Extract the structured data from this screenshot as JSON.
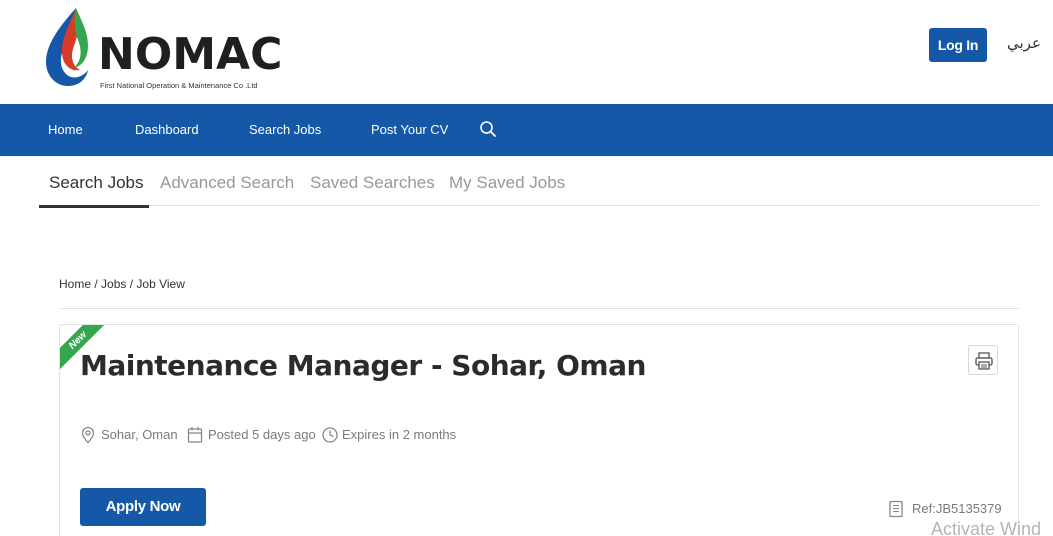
{
  "header": {
    "logo_text": "NOMAC",
    "logo_subtitle": "First National Operation & Maintenance Co .Ltd",
    "login_label": "Log In",
    "language_label": "عربي"
  },
  "nav": {
    "items": [
      {
        "label": "Home"
      },
      {
        "label": "Dashboard"
      },
      {
        "label": "Search Jobs"
      },
      {
        "label": "Post Your CV"
      }
    ],
    "search_icon": "search-icon"
  },
  "tabs": [
    {
      "label": "Search Jobs",
      "active": true
    },
    {
      "label": "Advanced Search",
      "active": false
    },
    {
      "label": "Saved Searches",
      "active": false
    },
    {
      "label": "My Saved Jobs",
      "active": false
    }
  ],
  "breadcrumb": {
    "home": "Home",
    "sep1": " / ",
    "jobs": "Jobs",
    "sep2": " / ",
    "current": "Job View"
  },
  "job": {
    "badge": "New",
    "title": "Maintenance Manager - Sohar, Oman",
    "location": "Sohar, Oman",
    "posted": "Posted 5 days ago",
    "expires": "Expires in 2 months",
    "apply_label": "Apply Now",
    "ref": "Ref:JB5135379"
  },
  "colors": {
    "brand_blue": "#1558a7",
    "new_badge_green": "#33a74d"
  },
  "watermark": "Activate Wind"
}
